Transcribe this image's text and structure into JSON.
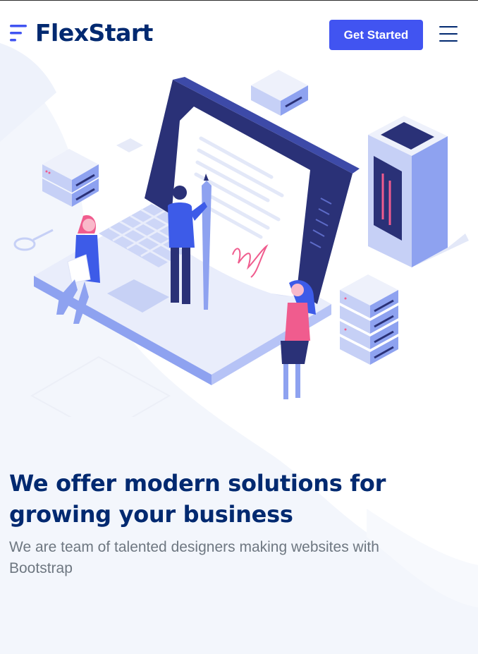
{
  "brand": {
    "name": "FlexStart",
    "color": "#012970",
    "accent": "#4154f1"
  },
  "header": {
    "cta_label": "Get Started"
  },
  "hero": {
    "title": "We offer modern solutions for growing your business",
    "subtitle": "We are team of talented designers making websites with Bootstrap"
  },
  "icons": {
    "logo": "flexstart-logo-icon",
    "menu": "hamburger-menu-icon"
  },
  "colors": {
    "subtitle": "#6e7781",
    "background_wash": "#f4f6fc"
  }
}
